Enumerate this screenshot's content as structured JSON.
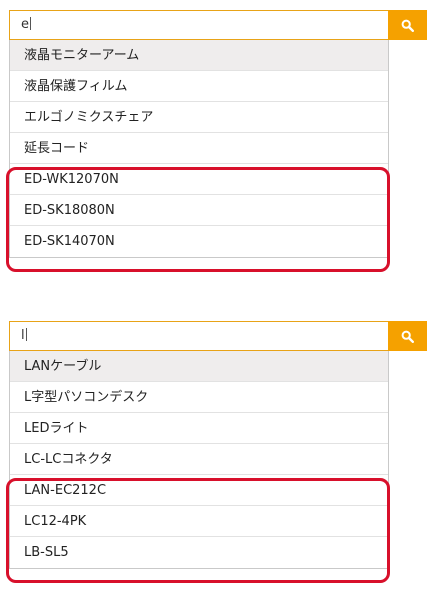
{
  "panels": [
    {
      "query": "e",
      "suggestions": [
        "液晶モニターアーム",
        "液晶保護フィルム",
        "エルゴノミクスチェア",
        "延長コード",
        "ED-WK12070N",
        "ED-SK18080N",
        "ED-SK14070N"
      ],
      "active_index": 0,
      "highlighted_from_index": 4
    },
    {
      "query": "l",
      "suggestions": [
        "LANケーブル",
        "L字型パソコンデスク",
        "LEDライト",
        "LC-LCコネクタ",
        "LAN-EC212C",
        "LC12-4PK",
        "LB-SL5"
      ],
      "active_index": 0,
      "highlighted_from_index": 4
    }
  ],
  "colors": {
    "search_button": "#f5a100",
    "search_border": "#e8a317",
    "highlight_box": "#d8102b",
    "active_row": "#efeded"
  },
  "icons": {
    "search_button": "search-icon"
  }
}
